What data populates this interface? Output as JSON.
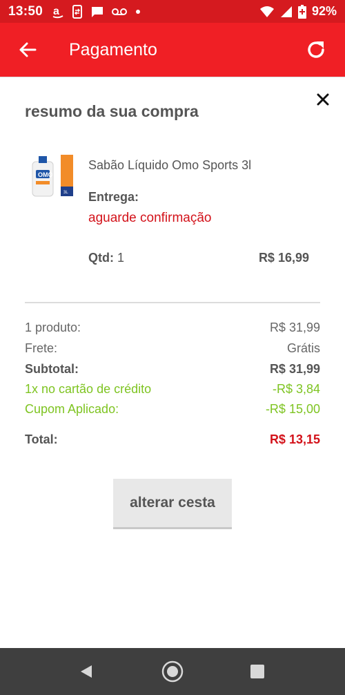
{
  "status_bar": {
    "time": "13:50",
    "battery_percent": "92%",
    "icons": [
      "amazon-icon",
      "phone-transfer-icon",
      "message-icon",
      "voicemail-icon",
      "dot-icon",
      "wifi-icon",
      "signal-icon",
      "battery-icon"
    ]
  },
  "app_bar": {
    "title": "Pagamento",
    "back_icon": "arrow-back-icon",
    "refresh_icon": "refresh-icon"
  },
  "summary_card": {
    "title": "resumo da sua compra",
    "close_icon": "close-icon",
    "product": {
      "name": "Sabão Líquido Omo Sports 3l",
      "delivery_label": "Entrega:",
      "delivery_status": "aguarde confirmação",
      "qty_label": "Qtd:",
      "qty_value": "1",
      "price": "R$ 16,99"
    },
    "totals": [
      {
        "label": "1 produto:",
        "value": "R$ 31,99",
        "style": "normal"
      },
      {
        "label": "Frete:",
        "value": "Grátis",
        "style": "normal"
      },
      {
        "label": "Subtotal:",
        "value": "R$ 31,99",
        "style": "bold"
      },
      {
        "label": "1x no cartão de crédito",
        "value": "-R$ 3,84",
        "style": "green"
      },
      {
        "label": "Cupom Aplicado:",
        "value": "-R$ 15,00",
        "style": "green"
      }
    ],
    "total": {
      "label": "Total:",
      "value": "R$ 13,15"
    },
    "alter_button_label": "alterar cesta"
  },
  "colors": {
    "primary_red": "#f01f25",
    "status_red": "#d51a1f",
    "discount_green": "#7ec421",
    "text_gray": "#555555"
  },
  "nav_bar": {
    "icons": [
      "nav-back-icon",
      "nav-home-icon",
      "nav-recents-icon"
    ]
  }
}
